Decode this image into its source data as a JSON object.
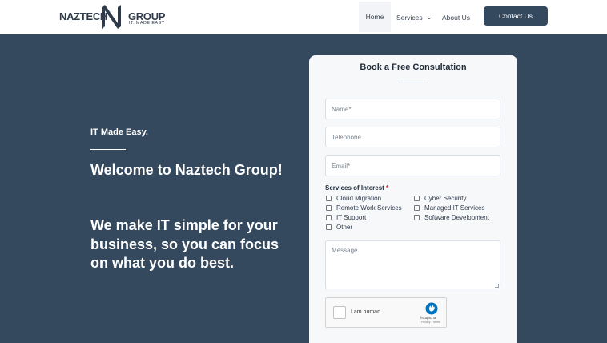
{
  "header": {
    "logo_left": "NAZTECH",
    "logo_right": "GROUP",
    "logo_tagline": "IT. MADE EASY",
    "nav": [
      {
        "label": "Home"
      },
      {
        "label": "Services"
      },
      {
        "label": "About Us"
      }
    ],
    "contact_label": "Contact Us"
  },
  "hero": {
    "tagline": "IT Made Easy.",
    "title": "Welcome to Naztech Group!",
    "subtitle": "We make IT simple for your business, so you can focus on what you do best."
  },
  "form": {
    "title": "Book a Free Consultation",
    "name_placeholder": "Name*",
    "telephone_placeholder": "Telephone",
    "email_placeholder": "Email*",
    "services_label": "Services of Interest",
    "required_mark": "*",
    "services": [
      "Cloud Migration",
      "Cyber Security",
      "Remote Work Services",
      "Managed IT Services",
      "IT Support",
      "Software Development",
      "Other"
    ],
    "message_placeholder": "Message",
    "captcha": {
      "label": "I am human",
      "brand": "hCaptcha",
      "links": "Privacy - Terms"
    }
  },
  "colors": {
    "hero_bg": "#34495e",
    "header_bg": "#ffffff",
    "button_bg": "#34495e",
    "card_bg": "#f7f8fa"
  }
}
